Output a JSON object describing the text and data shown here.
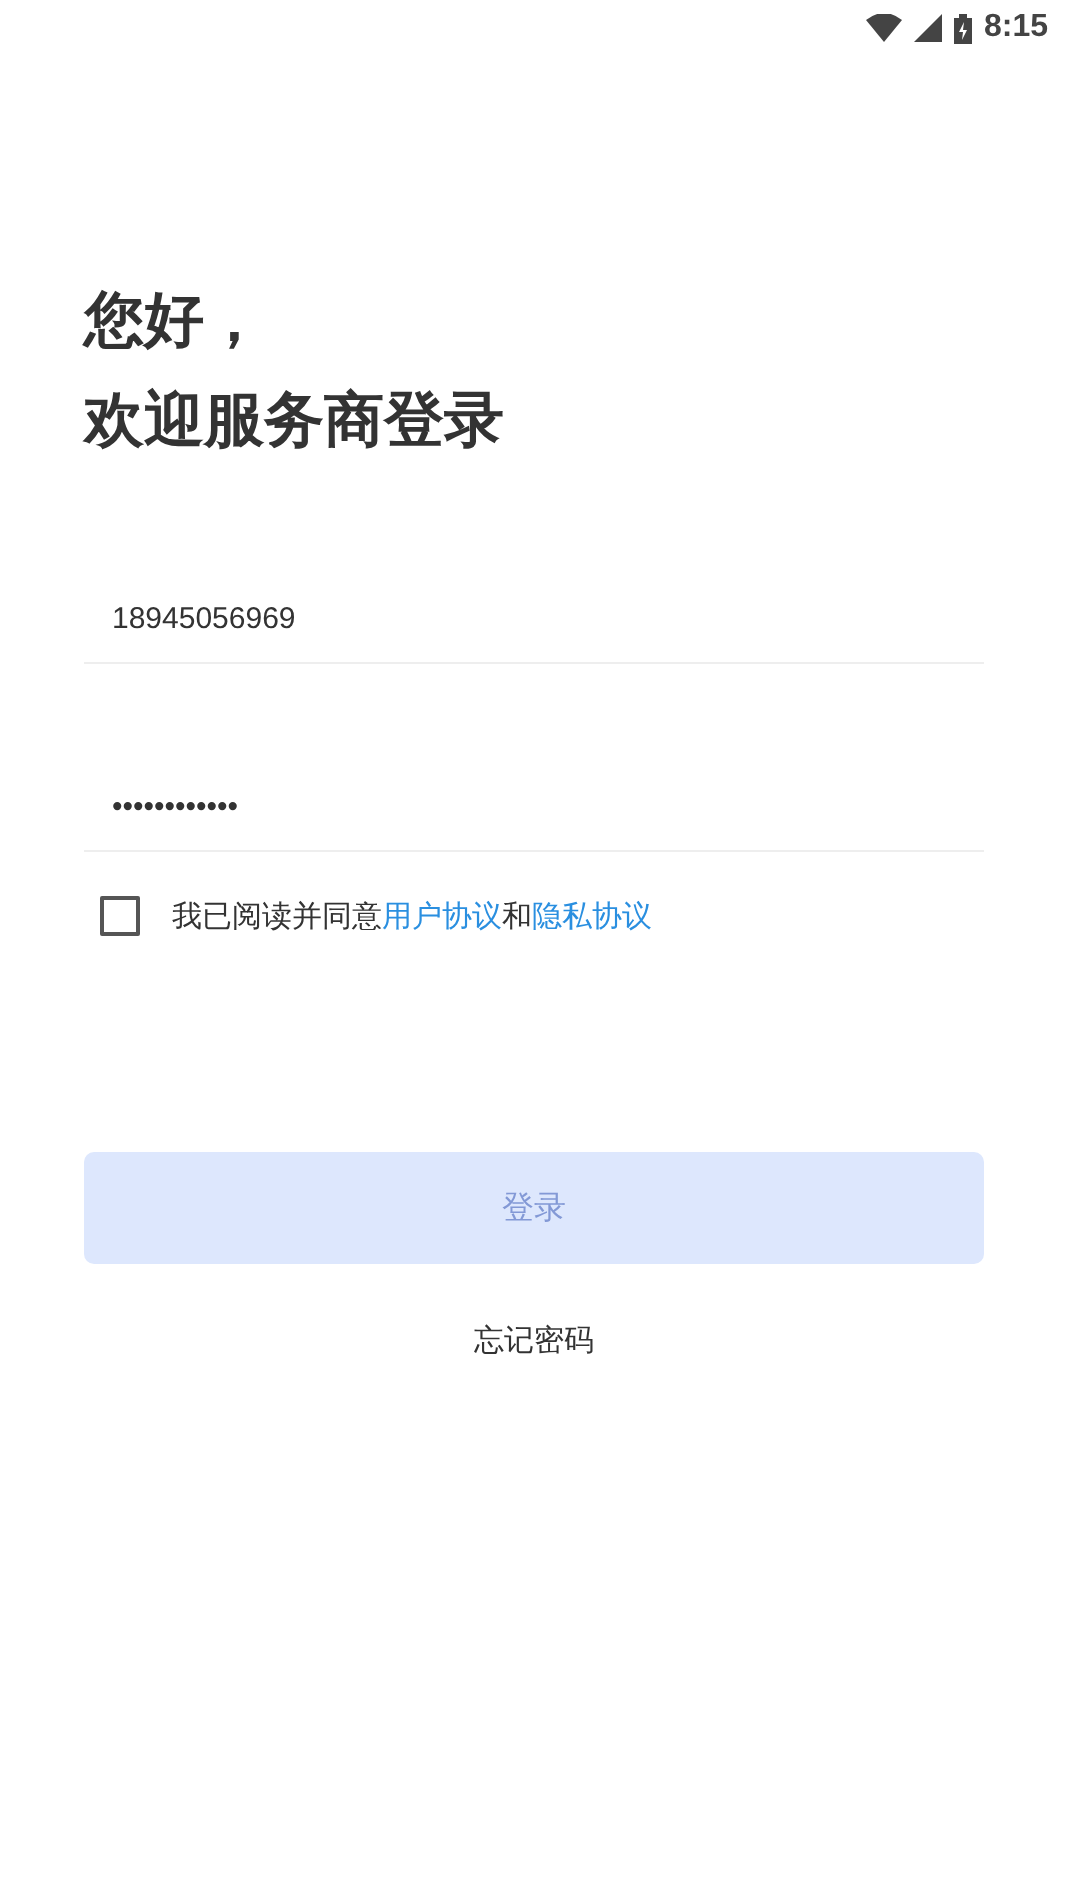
{
  "status_bar": {
    "time": "8:15"
  },
  "greeting": [
    "您好，",
    "欢迎服务商登录"
  ],
  "phone": {
    "value": "18945056969"
  },
  "password": {
    "value": "••••••••••••"
  },
  "agreement": {
    "checked": false,
    "prefix": "我已阅读并同意",
    "links": [
      "用户协议",
      "隐私协议"
    ],
    "joiner": "和"
  },
  "login_button": {
    "label": "登录",
    "disabled": true
  },
  "forgot_link": "忘记密码"
}
